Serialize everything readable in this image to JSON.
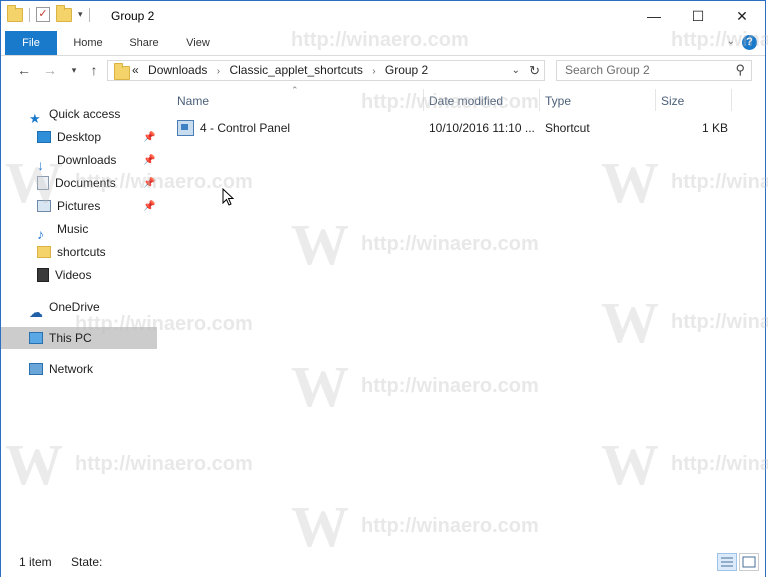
{
  "window": {
    "title": "Group 2"
  },
  "ribbon": {
    "tabs": [
      "File",
      "Home",
      "Share",
      "View"
    ],
    "help": "?"
  },
  "address": {
    "overflow": "«",
    "crumbs": [
      "Downloads",
      "Classic_applet_shortcuts",
      "Group 2"
    ],
    "separator": "›"
  },
  "search": {
    "placeholder": "Search Group 2"
  },
  "nav": {
    "items": [
      "Quick access",
      "Desktop",
      "Downloads",
      "Documents",
      "Pictures",
      "Music",
      "shortcuts",
      "Videos",
      "OneDrive",
      "This PC",
      "Network"
    ]
  },
  "columns": {
    "name": "Name",
    "date": "Date modified",
    "type": "Type",
    "size": "Size"
  },
  "files": [
    {
      "name": "4 - Control Panel",
      "date": "10/10/2016 11:10 ...",
      "type": "Shortcut",
      "size": "1 KB"
    }
  ],
  "status": {
    "count": "1 item",
    "state": "State:"
  },
  "watermark": {
    "text": "http://winaero.com",
    "letter": "W"
  },
  "colors": {
    "accent": "#1979ca",
    "selected": "#cccccc"
  }
}
